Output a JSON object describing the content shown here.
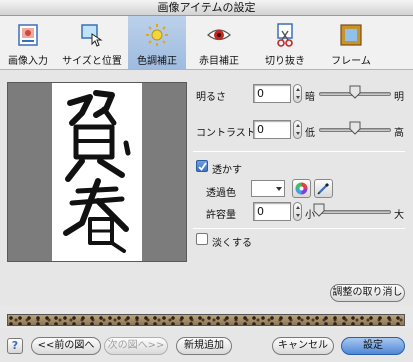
{
  "window": {
    "title": "画像アイテムの設定"
  },
  "toolbar": {
    "tabs": [
      {
        "label": "画像入力",
        "icon": "image-input-icon"
      },
      {
        "label": "サイズと位置",
        "icon": "size-position-icon"
      },
      {
        "label": "色調補正",
        "icon": "color-correction-icon",
        "active": true
      },
      {
        "label": "赤目補正",
        "icon": "red-eye-icon"
      },
      {
        "label": "切り抜き",
        "icon": "crop-icon"
      },
      {
        "label": "フレーム",
        "icon": "frame-icon"
      }
    ]
  },
  "preview": {
    "calligraphy": "賀春"
  },
  "adjust": {
    "brightness": {
      "label": "明るさ",
      "value": "0",
      "min_label": "暗",
      "max_label": "明",
      "level": 0.5
    },
    "contrast": {
      "label": "コントラスト",
      "value": "0",
      "min_label": "低",
      "max_label": "高",
      "level": 0.5
    }
  },
  "transparency": {
    "checkbox_label": "透かす",
    "checked": true,
    "color_label": "透過色",
    "tolerance_label": "許容量",
    "tolerance_value": "0",
    "min_label": "小",
    "max_label": "大",
    "level": 0.0
  },
  "fade": {
    "checkbox_label": "淡くする",
    "checked": false
  },
  "buttons": {
    "reset": "調整の取り消し",
    "prev": "<<前の図へ",
    "next": "次の図へ>>",
    "add_new": "新規追加",
    "cancel": "キャンセル",
    "ok": "設定",
    "help": "?"
  },
  "colors": {
    "accent": "#4f88d6",
    "active_tab": "#a9c3e6"
  }
}
